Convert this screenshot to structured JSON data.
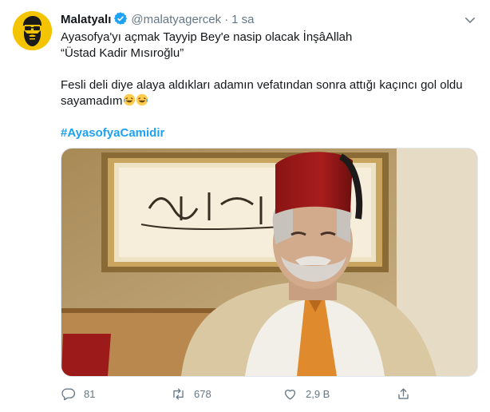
{
  "tweet": {
    "author_name": "Malatyalı",
    "handle": "@malatyagercek",
    "separator": "·",
    "time": "1 sa",
    "lines": [
      "Ayasofya'yı açmak Tayyip Bey'e nasip olacak İnşâAllah",
      "“Üstad Kadir Mısıroğlu”"
    ],
    "line3": "Fesli deli diye alaya aldıkları adamın vefatından sonra attığı kaçıncı gol oldu",
    "line4": "sayamadım",
    "hashtag": "#AyasofyaCamidir"
  },
  "actions": {
    "reply_count": "81",
    "retweet_count": "678",
    "like_count": "2,9 B",
    "share_count": ""
  },
  "colors": {
    "accent": "#1da1f2",
    "muted": "#657786",
    "avatar_bg": "#f5c400"
  },
  "icons": [
    "verified-badge-icon",
    "chevron-down-icon",
    "reply-icon",
    "retweet-icon",
    "like-icon",
    "share-icon",
    "rofl-emoji-icon"
  ]
}
